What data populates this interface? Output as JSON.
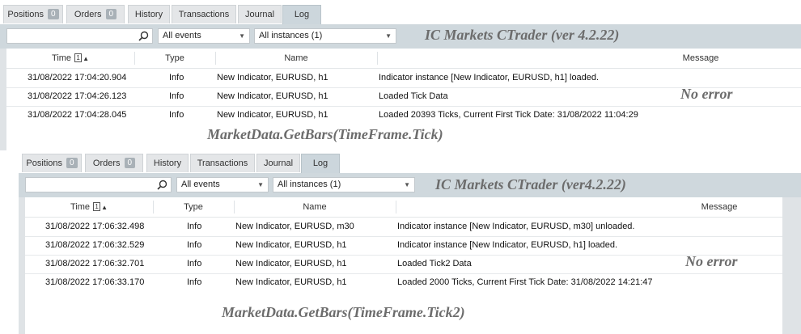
{
  "tabs_common": {
    "positions": "Positions",
    "positions_count": "0",
    "orders": "Orders",
    "orders_count": "0",
    "history": "History",
    "transactions": "Transactions",
    "journal": "Journal",
    "log": "Log"
  },
  "toolbar": {
    "search_value": "",
    "events_filter": "All events",
    "instances_filter": "All instances (1)"
  },
  "columns": {
    "time": "Time",
    "sort_index": "1",
    "type": "Type",
    "name": "Name",
    "message": "Message"
  },
  "panel1": {
    "title_annotation": "IC Markets CTrader (ver 4.2.22)",
    "note_annotation": "No error",
    "code_annotation": "MarketData.GetBars(TimeFrame.Tick)",
    "rows": [
      {
        "time": "31/08/2022 17:04:20.904",
        "type": "Info",
        "name": "New Indicator, EURUSD, h1",
        "message": "Indicator instance [New Indicator, EURUSD, h1] loaded."
      },
      {
        "time": "31/08/2022 17:04:26.123",
        "type": "Info",
        "name": "New Indicator, EURUSD, h1",
        "message": "Loaded Tick Data"
      },
      {
        "time": "31/08/2022 17:04:28.045",
        "type": "Info",
        "name": "New Indicator, EURUSD, h1",
        "message": "Loaded 20393 Ticks, Current First Tick Date: 31/08/2022 11:04:29"
      }
    ]
  },
  "panel2": {
    "title_annotation": "IC Markets CTrader (ver4.2.22)",
    "note_annotation": "No error",
    "code_annotation": "MarketData.GetBars(TimeFrame.Tick2)",
    "rows": [
      {
        "time": "31/08/2022 17:06:32.498",
        "type": "Info",
        "name": "New Indicator, EURUSD, m30",
        "message": "Indicator instance [New Indicator, EURUSD, m30] unloaded."
      },
      {
        "time": "31/08/2022 17:06:32.529",
        "type": "Info",
        "name": "New Indicator, EURUSD, h1",
        "message": "Indicator instance [New Indicator, EURUSD, h1] loaded."
      },
      {
        "time": "31/08/2022 17:06:32.701",
        "type": "Info",
        "name": "New Indicator, EURUSD, h1",
        "message": "Loaded Tick2 Data"
      },
      {
        "time": "31/08/2022 17:06:33.170",
        "type": "Info",
        "name": "New Indicator, EURUSD, h1",
        "message": "Loaded 2000 Ticks, Current First Tick Date: 31/08/2022 14:21:47"
      }
    ]
  },
  "icons": {
    "search": "search-icon",
    "dropdown": "chevron-down-icon"
  }
}
